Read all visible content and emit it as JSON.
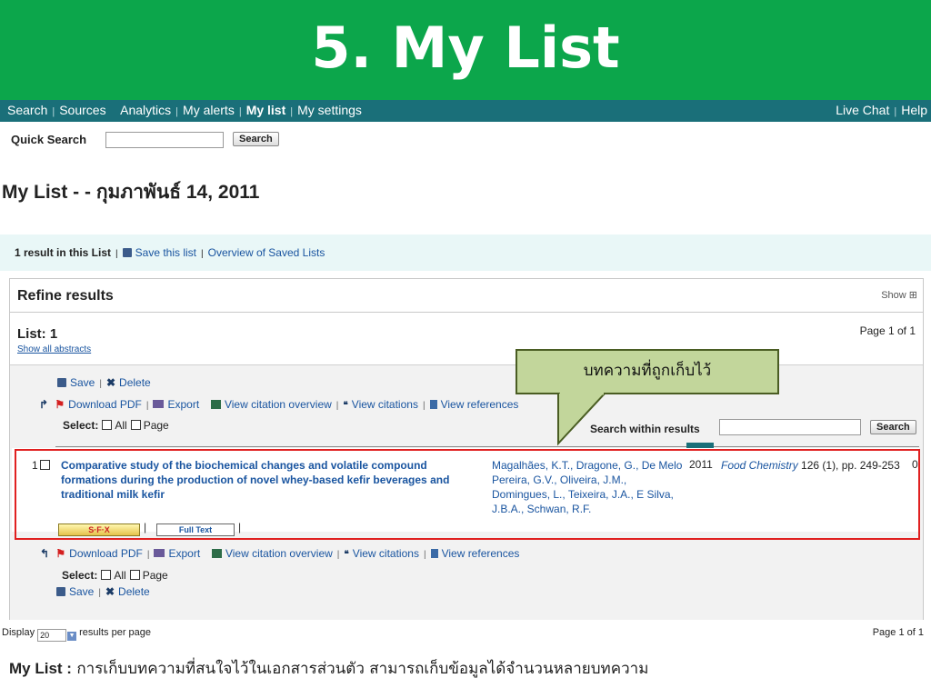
{
  "banner": {
    "title": "5. My List"
  },
  "nav": {
    "items": [
      "Search",
      "Sources",
      "Analytics",
      "My alerts",
      "My list",
      "My settings"
    ],
    "right": [
      "Live Chat",
      "Help"
    ]
  },
  "quick_search": {
    "label": "Quick Search",
    "button": "Search",
    "value": ""
  },
  "page_title": "My List -  - กุมภาพันธ์ 14, 2011",
  "list_bar": {
    "count": "1 result in this List",
    "save": "Save this list",
    "overview": "Overview of Saved Lists"
  },
  "refine": {
    "title": "Refine results",
    "show": "Show"
  },
  "list": {
    "count_label": "List: 1",
    "show_abstracts": "Show all abstracts",
    "page": "Page  1 of 1"
  },
  "toolbar": {
    "save": "Save",
    "delete": "Delete",
    "download_pdf": "Download PDF",
    "export": "Export",
    "citation_overview": "View citation overview",
    "view_citations": "View citations",
    "view_references": "View references",
    "select_label": "Select:",
    "all": "All",
    "page": "Page"
  },
  "search_within": {
    "label": "Search within results",
    "button": "Search",
    "value": ""
  },
  "result": {
    "number": "1",
    "title": "Comparative study of the biochemical changes and volatile compound formations during the production of novel whey-based kefir beverages and traditional milk kefir",
    "authors": "Magalhães, K.T., Dragone, G., De Melo Pereira, G.V., Oliveira, J.M., Domingues, L., Teixeira, J.A., E Silva, J.B.A., Schwan, R.F.",
    "year": "2011",
    "journal": "Food Chemistry",
    "source_rest": " 126 (1), pp. 249-253",
    "cited": "0",
    "sfx": "S·F·X",
    "full_text": "Full Text"
  },
  "callout": {
    "text": "บทความที่ถูกเก็บไว้"
  },
  "display": {
    "label": "Display",
    "value": "20",
    "suffix": "results per page",
    "page": "Page  1 of 1"
  },
  "caption": {
    "bold": "My List :",
    "text": " การเก็บบทความที่สนใจไว้ในเอกสารส่วนตัว สามารถเก็บข้อมูลได้จำนวนหลายบทความ"
  },
  "colors": {
    "banner": "#0ca64b",
    "nav": "#1a6f79",
    "highlight": "#e02020",
    "callout": "#c2d69b"
  }
}
